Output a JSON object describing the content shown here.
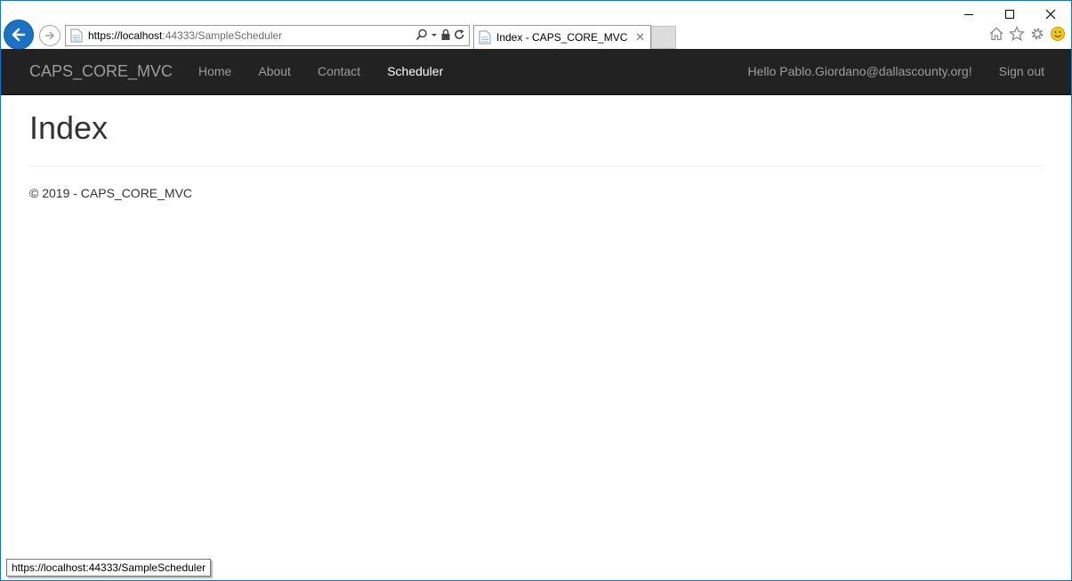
{
  "browser": {
    "address": {
      "protocol": "https://",
      "host": "localhost",
      "rest": ":44333/SampleScheduler"
    },
    "tab_title": "Index - CAPS_CORE_MVC",
    "tab_close": "✕",
    "status_url": "https://localhost:44333/SampleScheduler"
  },
  "navbar": {
    "brand": "CAPS_CORE_MVC",
    "links": [
      {
        "label": "Home"
      },
      {
        "label": "About"
      },
      {
        "label": "Contact"
      },
      {
        "label": "Scheduler"
      }
    ],
    "greeting": "Hello Pablo.Giordano@dallascounty.org!",
    "signout": "Sign out"
  },
  "main": {
    "title": "Index"
  },
  "footer": {
    "text": "© 2019 - CAPS_CORE_MVC"
  },
  "colors": {
    "navbar_bg": "#222222",
    "nav_link": "#9d9d9d",
    "nav_active": "#ffffff",
    "accent": "#1a72c3"
  }
}
